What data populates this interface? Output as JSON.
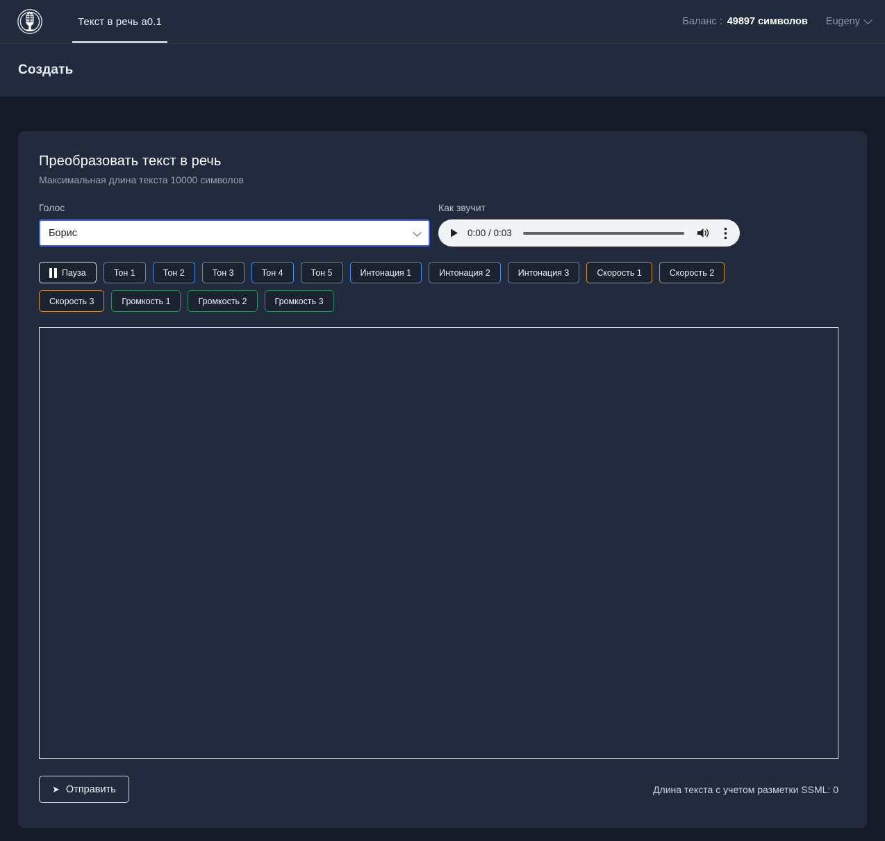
{
  "navbar": {
    "logo_icon": "microphone-logo-icon",
    "tabs": [
      {
        "label": "Текст в речь a0.1",
        "active": true
      }
    ],
    "balance_label": "Баланс :",
    "balance_value": "49897 символов",
    "user_name": "Eugeny",
    "user_chevron_icon": "chevron-down-icon"
  },
  "page": {
    "title": "Создать"
  },
  "card": {
    "title": "Преобразовать текст в речь",
    "subtitle": "Максимальная длина текста 10000 символов",
    "voice": {
      "label": "Голос",
      "value": "Борис",
      "options": [
        "Борис"
      ],
      "chevron_icon": "chevron-down-icon"
    },
    "audio": {
      "label": "Как звучит",
      "play_icon": "play-icon",
      "time": "0:00 / 0:03",
      "volume_icon": "volume-icon",
      "menu_icon": "more-vertical-icon"
    },
    "tags": [
      {
        "label": "Пауза",
        "style": "neutral",
        "icon": "pause-icon"
      },
      {
        "label": "Тон 1",
        "style": "blue",
        "icon": null
      },
      {
        "label": "Тон 2",
        "style": "blue",
        "icon": null
      },
      {
        "label": "Тон 3",
        "style": "blue",
        "icon": null
      },
      {
        "label": "Тон 4",
        "style": "blue",
        "icon": null
      },
      {
        "label": "Тон 5",
        "style": "blue",
        "icon": null
      },
      {
        "label": "Интонация 1",
        "style": "blue",
        "icon": null
      },
      {
        "label": "Интонация 2",
        "style": "blue",
        "icon": null
      },
      {
        "label": "Интонация 3",
        "style": "blue",
        "icon": null
      },
      {
        "label": "Скорость 1",
        "style": "orange",
        "icon": null
      },
      {
        "label": "Скорость 2",
        "style": "orange",
        "icon": null
      },
      {
        "label": "Скорость 3",
        "style": "orange",
        "icon": null
      },
      {
        "label": "Громкость 1",
        "style": "green",
        "icon": null
      },
      {
        "label": "Громкость 2",
        "style": "green",
        "icon": null
      },
      {
        "label": "Громкость 3",
        "style": "green",
        "icon": null
      }
    ],
    "editor": {
      "value": "",
      "placeholder": ""
    },
    "submit": {
      "label": "Отправить",
      "icon": "send-icon"
    },
    "ssml_length": "Длина текста с учетом разметки SSML: 0"
  },
  "colors": {
    "page_bg": "#141a27",
    "panel_bg": "#212b3d",
    "accent_blue": "#4a8df0",
    "accent_orange": "#d4932a",
    "accent_green": "#2f8f62",
    "select_focus": "#3d6ae0"
  }
}
